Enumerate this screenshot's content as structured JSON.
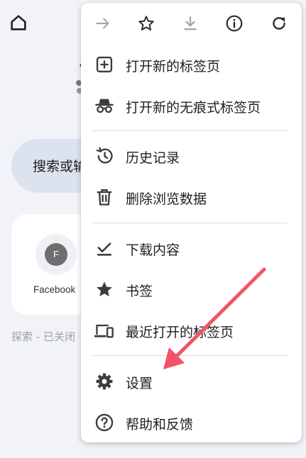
{
  "background": {
    "search_text": "搜索或输",
    "shortcut": {
      "letter": "F",
      "label": "Facebook"
    },
    "discover_text": "探索 - 已关闭"
  },
  "toolbar": {
    "icons": [
      "forward-icon",
      "star-icon",
      "download-icon",
      "info-icon",
      "refresh-icon"
    ]
  },
  "menu": {
    "items": [
      {
        "label": "打开新的标签页",
        "icon": "new-tab-icon"
      },
      {
        "label": "打开新的无痕式标签页",
        "icon": "incognito-icon"
      },
      {
        "label": "历史记录",
        "icon": "history-icon"
      },
      {
        "label": "删除浏览数据",
        "icon": "trash-icon"
      },
      {
        "label": "下载内容",
        "icon": "downloads-icon"
      },
      {
        "label": "书签",
        "icon": "bookmark-star-icon"
      },
      {
        "label": "最近打开的标签页",
        "icon": "devices-icon"
      },
      {
        "label": "设置",
        "icon": "settings-gear-icon"
      },
      {
        "label": "帮助和反馈",
        "icon": "help-icon"
      }
    ]
  },
  "colors": {
    "page_bg": "#f1f3f8",
    "search_pill": "#dde3ee",
    "icon": "#3c3c3c",
    "disabled_icon": "#a8a8a8",
    "annotation_arrow": "#f2536b"
  }
}
